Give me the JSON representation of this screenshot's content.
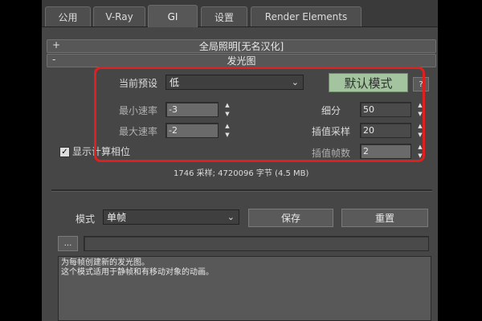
{
  "tabs": [
    "公用",
    "V-Ray",
    "GI",
    "设置",
    "Render Elements"
  ],
  "rollouts": {
    "global": {
      "sign": "+",
      "title": "全局照明[无名汉化]"
    },
    "irradiance": {
      "sign": "-",
      "title": "发光图"
    }
  },
  "preset": {
    "label": "当前预设",
    "value": "低",
    "default_button": "默认模式",
    "help_button": "?"
  },
  "min_rate": {
    "label": "最小速率",
    "value": "-3"
  },
  "max_rate": {
    "label": "最大速率",
    "value": "-2"
  },
  "subdivs": {
    "label": "细分",
    "value": "50"
  },
  "interp_samples": {
    "label": "插值采样",
    "value": "20"
  },
  "interp_frames": {
    "label": "插值帧数",
    "value": "2"
  },
  "show_calc": {
    "label": "显示计算相位",
    "checked": true,
    "check_glyph": "✓"
  },
  "stats": "1746 采样; 4720096 字节 (4.5 MB)",
  "mode": {
    "label": "模式",
    "value": "单帧",
    "save_button": "保存",
    "reset_button": "重置"
  },
  "browse_button": "...",
  "description_lines": [
    "为每帧创建新的发光图。",
    "这个模式适用于静帧和有移动对象的动画。"
  ],
  "colors": {
    "highlight_border": "#e21f1f",
    "default_button_bg": "#a3c49f"
  }
}
